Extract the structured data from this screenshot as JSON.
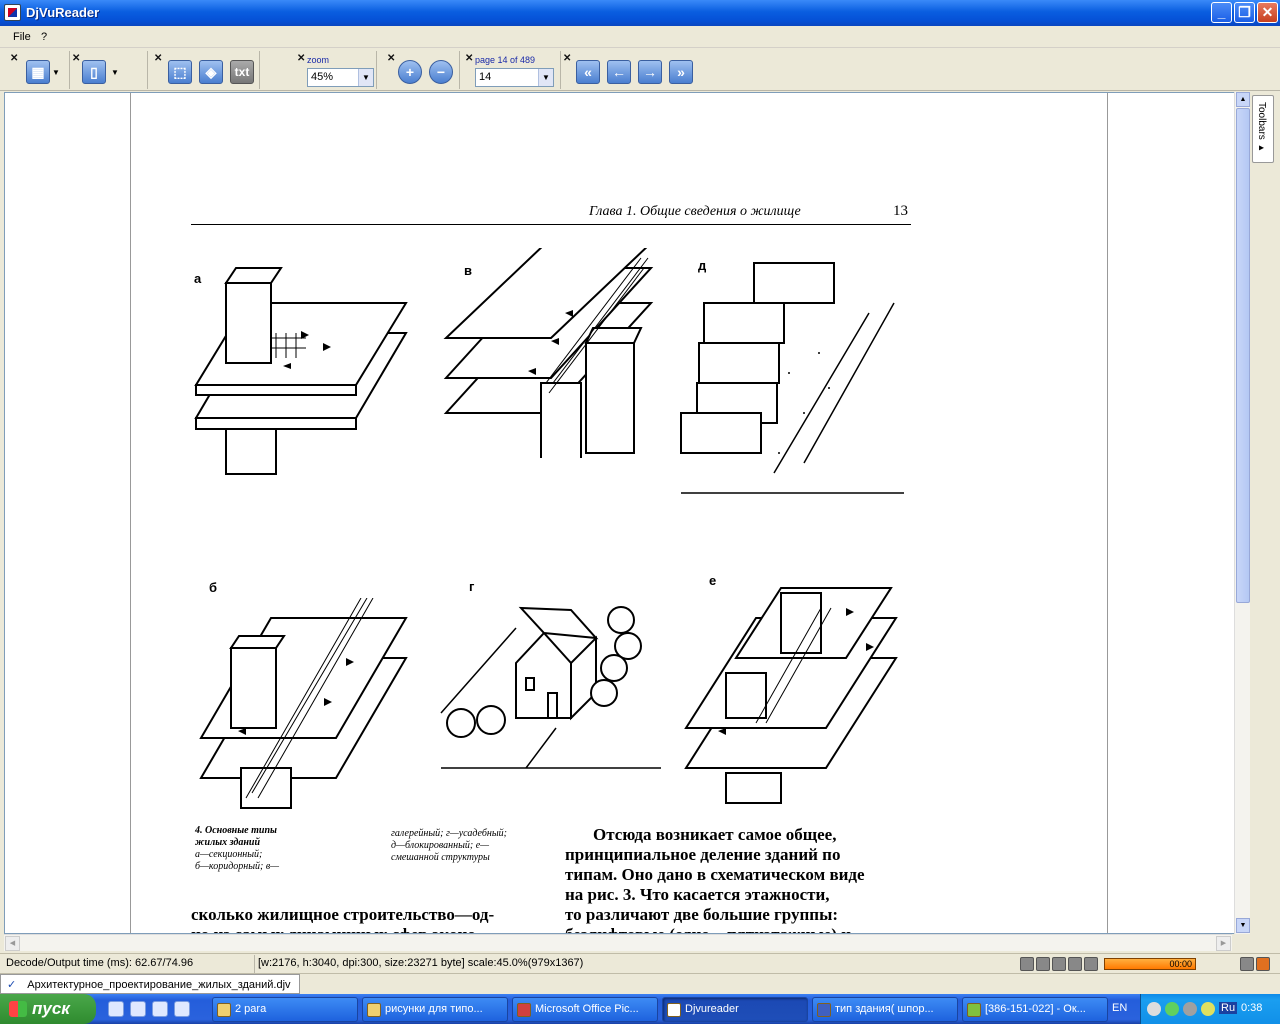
{
  "window": {
    "title": "DjVuReader",
    "min": "_",
    "max": "❐",
    "close": "✕"
  },
  "menu": {
    "file": "File",
    "help": "?"
  },
  "toolbar": {
    "text_btn": "txt",
    "zoom_label": "zoom",
    "zoom_value": "45%",
    "page_label": "page 14 of 489",
    "page_value": "14"
  },
  "toolbars_tab": "Toolbars ▸",
  "book": {
    "header": "Глава 1. Общие сведения о жилище",
    "page_number": "13",
    "figure_letters": [
      "а",
      "в",
      "д",
      "б",
      "г",
      "е"
    ],
    "caption_left": [
      "4. Основные типы",
      "жилых зданий",
      "а—секционный;",
      "б—коридорный; в—"
    ],
    "caption_right": [
      "галерейный; г—усадебный;",
      "д—блокированный; е—",
      "смешанной структуры"
    ],
    "body_left": [
      "сколько жилищное строительство—од-",
      "но из самых динамичных сфер эконо-"
    ],
    "body_right": [
      "Отсюда возникает самое общее,",
      "принципиальное деление зданий по",
      "типам. Оно дано в схематическом виде",
      "на рис. 3. Что касается этажности,",
      "то различают две большие группы:",
      "безлифтовые (одно—пятиэтажные) и"
    ]
  },
  "status": {
    "decode": "Decode/Output time (ms): 62.67/74.96",
    "info": "[w:2176, h:3040, dpi:300, size:23271 byte] scale:45.0%(979x1367)",
    "player_time": "00:00"
  },
  "doc_tab": "Архитектурное_проектирование_жилых_зданий.djv",
  "taskbar": {
    "start": "пуск",
    "tasks": [
      "2 para",
      "рисунки для типо...",
      "Microsoft Office Pic...",
      "Djvureader",
      "тип здания( шпор...",
      "[386-151-022] - Ок..."
    ],
    "lang": "EN",
    "tray_lang": "Ru",
    "clock": "0:38"
  },
  "colors": {
    "titlebar": "#0a5ee0",
    "taskbar": "#245edb",
    "start": "#3c9a3c",
    "tray": "#1190e8"
  }
}
